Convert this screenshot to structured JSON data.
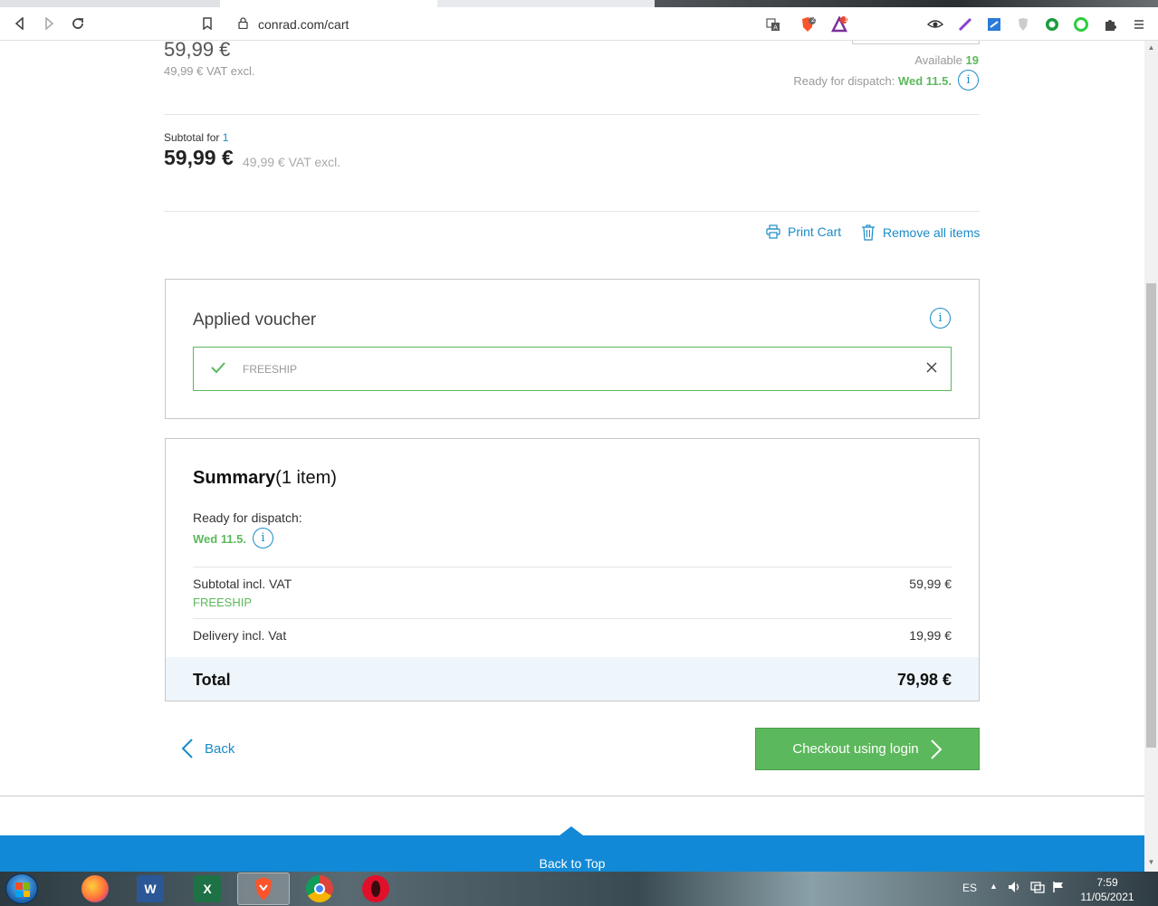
{
  "browser": {
    "url": "conrad.com/cart",
    "brave_badge": "2",
    "alert_badge": "1"
  },
  "item": {
    "price": "59,99 €",
    "price_vat_excl": "49,99 € VAT excl.",
    "available_label": "Available",
    "available_count": "19",
    "dispatch_label": "Ready for dispatch:",
    "dispatch_date": "Wed 11.5."
  },
  "subtotal": {
    "label_prefix": "Subtotal for ",
    "count": "1",
    "value": "59,99 €",
    "vat_excl": "49,99 € VAT excl."
  },
  "actions": {
    "print_cart": "Print Cart",
    "remove_all": "Remove all items"
  },
  "voucher": {
    "title": "Applied voucher",
    "code": "FREESHIP"
  },
  "summary": {
    "title": "Summary",
    "item_count": "(1 item)",
    "dispatch_label": "Ready for dispatch:",
    "dispatch_date": "Wed 11.5.",
    "subtotal_label": "Subtotal incl. VAT",
    "subtotal_value": "59,99 €",
    "voucher_code": "FREESHIP",
    "delivery_label": "Delivery incl. Vat",
    "delivery_value": "19,99 €",
    "total_label": "Total",
    "total_value": "79,98 €"
  },
  "nav": {
    "back": "Back",
    "checkout": "Checkout using login",
    "back_to_top": "Back to Top"
  },
  "taskbar": {
    "language": "ES",
    "time": "7:59",
    "date": "11/05/2021"
  },
  "colors": {
    "accent": "#1a8bc8",
    "success": "#5cb85c",
    "footer": "#1189d6"
  }
}
